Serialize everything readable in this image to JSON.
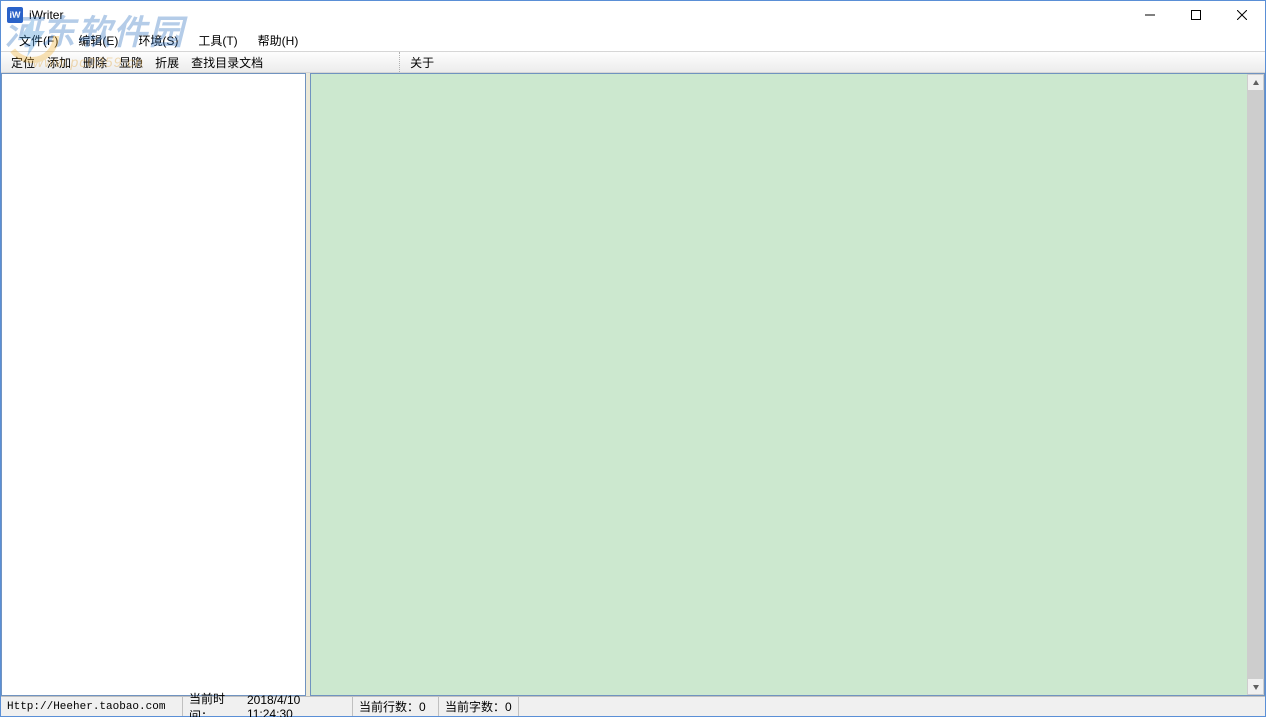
{
  "title": "iWriter",
  "menubar": [
    {
      "label": "文件(F)"
    },
    {
      "label": "编辑(E)"
    },
    {
      "label": "环境(S)"
    },
    {
      "label": "工具(T)"
    },
    {
      "label": "帮助(H)"
    }
  ],
  "toolbar": {
    "group1": [
      "定位",
      "添加",
      "删除",
      "显隐",
      "折展",
      "查找目录文档"
    ],
    "group2": [
      "关于"
    ]
  },
  "editor": {
    "content": "",
    "bg_color": "#cce8cf"
  },
  "statusbar": {
    "url": "Http://Heeher.taobao.com",
    "time_label": "当前时间：",
    "time_value": "2018/4/10 11:24:30",
    "lines_label": "当前行数：",
    "lines_value": "0",
    "chars_label": "当前字数：",
    "chars_value": "0"
  },
  "watermark": {
    "main": "河东软件园",
    "sub": "www.pc0359.cn"
  }
}
